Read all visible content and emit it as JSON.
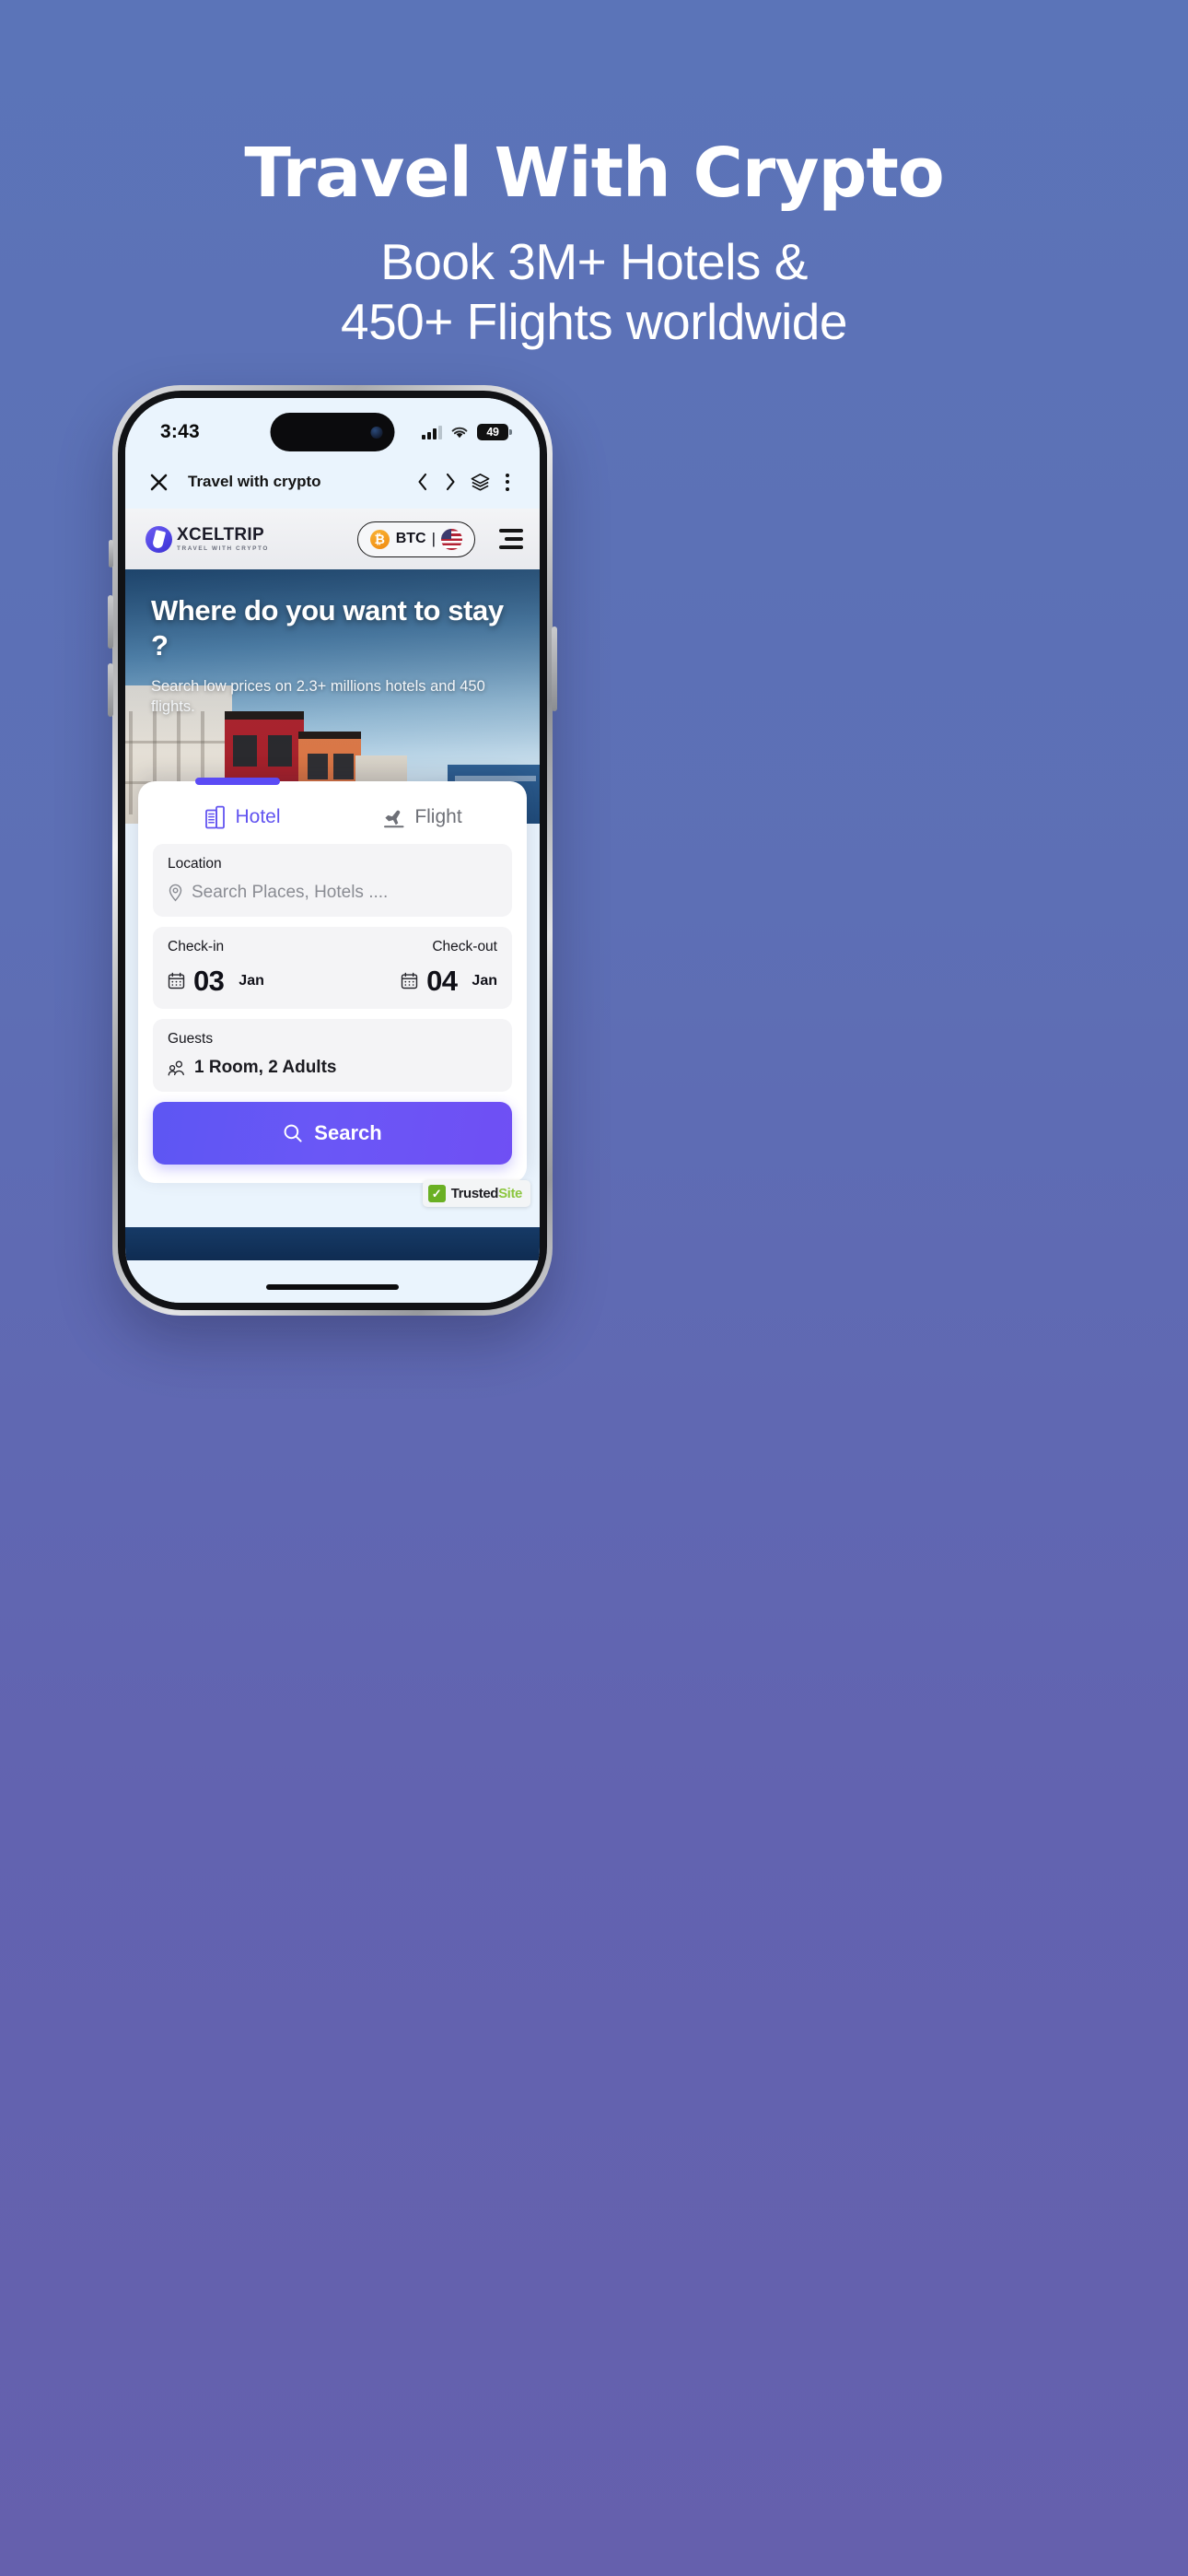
{
  "promo": {
    "title": "Travel With Crypto",
    "subtitle_line1": "Book 3M+ Hotels &",
    "subtitle_line2": "450+ Flights worldwide",
    "background_top": "#5b74b8",
    "background_bottom": "#6560ad"
  },
  "status_bar": {
    "time": "3:43",
    "signal_icon": "cellular-signal-icon",
    "wifi_icon": "wifi-icon",
    "battery_level": "49",
    "battery_icon": "battery-icon"
  },
  "browser_bar": {
    "close_icon": "close-icon",
    "title": "Travel with crypto",
    "back_icon": "chevron-left-icon",
    "forward_icon": "chevron-right-icon",
    "tabs_icon": "layers-icon",
    "menu_icon": "kebab-menu-icon"
  },
  "site_header": {
    "logo_name": "XCELTRIP",
    "logo_tagline": "TRAVEL WITH CRYPTO",
    "logo_icon": "xceltrip-logo-icon",
    "currency_symbol": "₿",
    "currency_label": "BTC",
    "divider": "|",
    "flag_icon": "us-flag-icon",
    "menu_icon": "hamburger-menu-icon"
  },
  "hero": {
    "heading": "Where do you want to stay ?",
    "subtext": "Search low prices on 2.3+ millions hotels and 450 flights."
  },
  "search_card": {
    "tabs": [
      {
        "label": "Hotel",
        "icon": "hotel-building-icon",
        "active": true
      },
      {
        "label": "Flight",
        "icon": "airplane-takeoff-icon",
        "active": false
      }
    ],
    "location": {
      "label": "Location",
      "placeholder": "Search Places, Hotels ....",
      "icon": "map-pin-icon",
      "value": ""
    },
    "check_in": {
      "label": "Check-in",
      "day": "03",
      "month": "Jan",
      "icon": "calendar-icon"
    },
    "check_out": {
      "label": "Check-out",
      "day": "04",
      "month": "Jan",
      "icon": "calendar-icon"
    },
    "guests": {
      "label": "Guests",
      "value": "1 Room, 2 Adults",
      "icon": "guests-people-icon"
    },
    "search_button": {
      "label": "Search",
      "icon": "search-icon",
      "color": "#6254f0"
    }
  },
  "trusted_site": {
    "name_dark": "Trusted",
    "name_green": "Site",
    "check_icon": "check-badge-icon"
  }
}
